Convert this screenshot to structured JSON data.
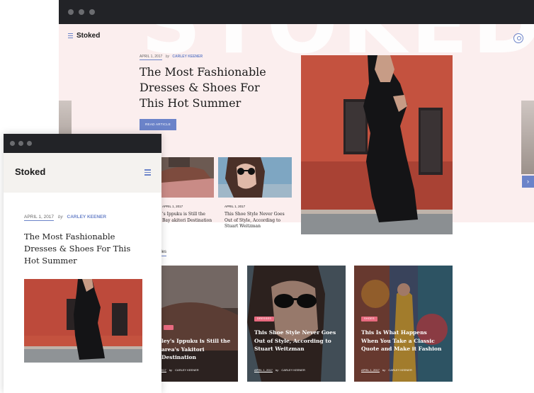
{
  "desktop": {
    "brand": "Stoked",
    "watermark": "STOKED",
    "featured": {
      "date": "APRIL 1, 2017",
      "by": "by",
      "author": "CARLEY KEENER",
      "title": "The Most Fashionable Dresses & Shoes For This Hot Summer",
      "button": "READ ARTICLE"
    },
    "small_cards": [
      {
        "date": "APRIL 1, 2017",
        "title": "'s Ippuku is Still the Bay akitori Destination"
      },
      {
        "date": "APRIL 1, 2017",
        "title": "This Shoe Style Never Goes Out of Style, According to Stuart Weitzman"
      }
    ],
    "section_label": "icles",
    "cards": [
      {
        "tag": "",
        "title": "ley's Ippuku is Still the area's Yakitori Destination",
        "date": "017",
        "by": "by",
        "author": "CARLEY KEENER"
      },
      {
        "tag": "DRESSES",
        "title": "This Shoe Style Never Goes Out of Style, According to Stuart Weitzman",
        "date": "APRIL 1, 2017",
        "by": "by",
        "author": "CARLEY KEENER"
      },
      {
        "tag": "SHOES",
        "title": "This Is What Happens When You Take a Classic Quote and Make it Fashion",
        "date": "APRIL 1, 2017",
        "by": "by",
        "author": "CARLEY KEENER"
      }
    ],
    "next_arrow": "›"
  },
  "mobile": {
    "brand": "Stoked",
    "date": "APRIL 1, 2017",
    "by": "by",
    "author": "CARLEY KEENER",
    "title": "The Most Fashionable Dresses & Shoes For This Hot Summer"
  },
  "icons": [
    "menu-icon",
    "search-icon",
    "chevron-right-icon",
    "window-dot-icon"
  ],
  "colors": {
    "accent": "#6b83c9",
    "hero_bg": "#fbeeee",
    "tag": "#e86a7f",
    "chrome": "#222327"
  }
}
